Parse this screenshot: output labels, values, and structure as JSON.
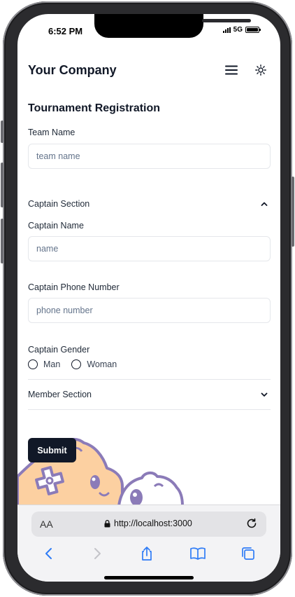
{
  "status_bar": {
    "time": "6:52 PM",
    "network": "5G"
  },
  "header": {
    "brand": "Your Company"
  },
  "form": {
    "title": "Tournament Registration",
    "team_name": {
      "label": "Team Name",
      "placeholder": "team name"
    },
    "captain_section": {
      "label": "Captain Section"
    },
    "captain_name": {
      "label": "Captain Name",
      "placeholder": "name"
    },
    "captain_phone": {
      "label": "Captain Phone Number",
      "placeholder": "phone number"
    },
    "captain_gender": {
      "label": "Captain Gender",
      "options": [
        "Man",
        "Woman"
      ]
    },
    "member_section": {
      "label": "Member Section"
    },
    "submit_label": "Submit"
  },
  "browser": {
    "aa_label": "AA",
    "url": "http://localhost:3000"
  },
  "icons": {
    "menu": "hamburger-menu-icon",
    "theme": "sun-icon",
    "chevron_up": "chevron-up-icon",
    "chevron_down": "chevron-down-icon",
    "lock": "lock-icon",
    "reload": "reload-icon",
    "back": "back-arrow-icon",
    "forward": "forward-arrow-icon",
    "share": "share-icon",
    "bookmarks": "book-icon",
    "tabs": "tabs-icon"
  },
  "colors": {
    "primary": "#111827",
    "border": "#e5e7eb",
    "placeholder": "#64748b",
    "mascot_fill": "#fcd0a1",
    "mascot_stroke": "#8b7bb8",
    "accent_blue": "#2f7cf6"
  }
}
